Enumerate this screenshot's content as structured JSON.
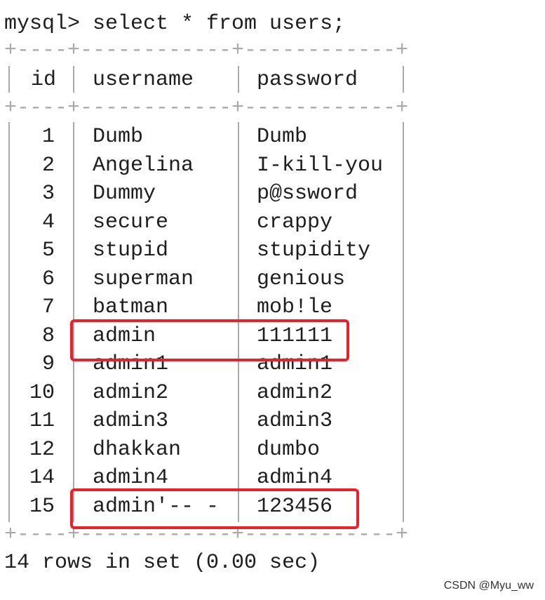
{
  "terminal": {
    "prompt": "mysql> select * from users;",
    "border": "+----+------------+------------+",
    "columns": [
      "id",
      "username",
      "password"
    ],
    "rows": [
      {
        "id": "1",
        "username": "Dumb",
        "password": "Dumb"
      },
      {
        "id": "2",
        "username": "Angelina",
        "password": "I-kill-you"
      },
      {
        "id": "3",
        "username": "Dummy",
        "password": "p@ssword"
      },
      {
        "id": "4",
        "username": "secure",
        "password": "crappy"
      },
      {
        "id": "5",
        "username": "stupid",
        "password": "stupidity"
      },
      {
        "id": "6",
        "username": "superman",
        "password": "genious"
      },
      {
        "id": "7",
        "username": "batman",
        "password": "mob!le"
      },
      {
        "id": "8",
        "username": "admin",
        "password": "111111"
      },
      {
        "id": "9",
        "username": "admin1",
        "password": "admin1"
      },
      {
        "id": "10",
        "username": "admin2",
        "password": "admin2"
      },
      {
        "id": "11",
        "username": "admin3",
        "password": "admin3"
      },
      {
        "id": "12",
        "username": "dhakkan",
        "password": "dumbo"
      },
      {
        "id": "14",
        "username": "admin4",
        "password": "admin4"
      },
      {
        "id": "15",
        "username": "admin'-- -",
        "password": "123456"
      }
    ],
    "footer": "14 rows in set (0.00 sec)"
  },
  "highlight_color": "#e8212a",
  "watermark": "CSDN @Myu_ww"
}
